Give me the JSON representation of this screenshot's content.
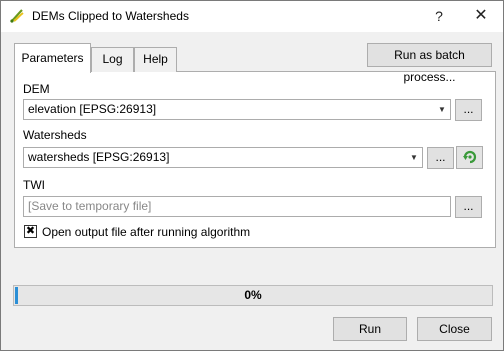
{
  "window": {
    "title": "DEMs Clipped to Watersheds",
    "help_glyph": "?",
    "close_glyph": "✕"
  },
  "tabs": [
    {
      "label": "Parameters",
      "active": true
    },
    {
      "label": "Log",
      "active": false
    },
    {
      "label": "Help",
      "active": false
    }
  ],
  "batch_button": "Run as batch process...",
  "params": {
    "dem": {
      "label": "DEM",
      "value": "elevation [EPSG:26913]",
      "browse": "..."
    },
    "watersheds": {
      "label": "Watersheds",
      "value": "watersheds [EPSG:26913]",
      "browse": "..."
    },
    "twi": {
      "label": "TWI",
      "placeholder": "[Save to temporary file]",
      "browse": "..."
    },
    "open_output": {
      "label": "Open output file after running algorithm",
      "checked": true,
      "mark": "✖"
    }
  },
  "progress": {
    "value": 0,
    "text": "0%"
  },
  "buttons": {
    "run": "Run",
    "close": "Close"
  },
  "colors": {
    "progress": "#2b8fd6",
    "iterate_icon": "#3a9a3a"
  }
}
